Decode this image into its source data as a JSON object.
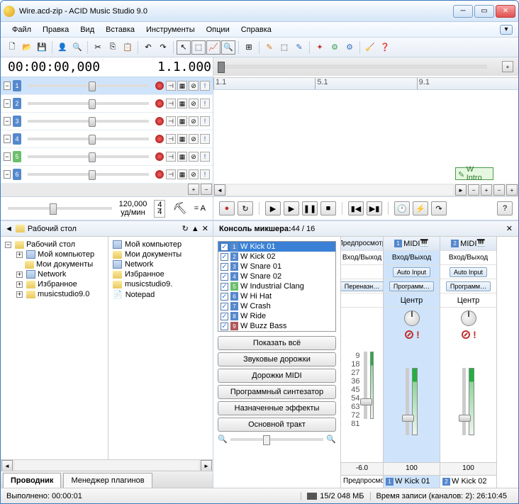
{
  "window": {
    "title": "Wire.acd-zip - ACID Music Studio 9.0"
  },
  "menu": {
    "file": "Файл",
    "edit": "Правка",
    "view": "Вид",
    "insert": "Вставка",
    "tools": "Инструменты",
    "options": "Опции",
    "help": "Справка"
  },
  "timecode": "00:00:00,000",
  "beat": "1.1.000",
  "ruler": {
    "a": "1.1",
    "b": "5.1",
    "c": "9.1"
  },
  "tracks": [
    {
      "n": "1",
      "sel": true
    },
    {
      "n": "2",
      "sel": false
    },
    {
      "n": "3",
      "sel": false
    },
    {
      "n": "4",
      "sel": false
    },
    {
      "n": "5",
      "sel": false,
      "green": true
    },
    {
      "n": "6",
      "sel": false
    }
  ],
  "clip": "W Intro",
  "bpm": {
    "value": "120,000",
    "unit": "уд/мин"
  },
  "timesig": {
    "num": "4",
    "den": "4"
  },
  "key": "= A",
  "explorer": {
    "root": "Рабочий стол",
    "tree": {
      "desktop": "Рабочий стол",
      "computer": "Мой компьютер",
      "documents": "Мои документы",
      "network": "Network",
      "favorites": "Избранное",
      "studio": "musicstudio9.0"
    },
    "files": {
      "computer": "Мой компьютер",
      "documents": "Мои документы",
      "network": "Network",
      "favorites": "Избранное",
      "studio": "musicstudio9.",
      "notepad": "Notepad"
    },
    "tabs": {
      "explorer": "Проводник",
      "plugins": "Менеджер плагинов"
    }
  },
  "mixer": {
    "title": "Консоль микшера: ",
    "count": "44 / 16",
    "buses": [
      {
        "n": "1",
        "label": "W Kick 01",
        "c": "#5588cc",
        "sel": true
      },
      {
        "n": "2",
        "label": "W Kick 02",
        "c": "#5588cc"
      },
      {
        "n": "3",
        "label": "W Snare 01",
        "c": "#5588cc"
      },
      {
        "n": "4",
        "label": "W Snare 02",
        "c": "#5588cc"
      },
      {
        "n": "5",
        "label": "W Industrial Clang",
        "c": "#6bbf6b"
      },
      {
        "n": "6",
        "label": "W Hi Hat",
        "c": "#5588cc"
      },
      {
        "n": "7",
        "label": "W Crash",
        "c": "#5588cc"
      },
      {
        "n": "8",
        "label": "W Ride",
        "c": "#5588cc"
      },
      {
        "n": "9",
        "label": "W Buzz Bass",
        "c": "#b05858"
      }
    ],
    "buttons": {
      "showall": "Показать всё",
      "audio": "Звуковые дорожки",
      "midi": "Дорожки MIDI",
      "synth": "Программный синтезатор",
      "fx": "Назначенные эффекты",
      "master": "Основной тракт"
    },
    "preview": "Предпросмотр",
    "io": "Вход/Выход",
    "autoinput": "Auto Input",
    "reassign": "Переназн…",
    "program": "Программ…",
    "center": "Центр",
    "meter_scale": [
      "9",
      "18",
      "27",
      "36",
      "45",
      "54",
      "63",
      "72",
      "81"
    ],
    "db_low": "-6.0",
    "val100": "100",
    "midi": "MIDI",
    "ch1": "W Kick 01",
    "ch2": "W Kick 02"
  },
  "status": {
    "done": "Выполнено: 00:00:01",
    "mem": "15/2 048 МБ",
    "rec": "Время записи (каналов: 2): 26:10:45"
  }
}
